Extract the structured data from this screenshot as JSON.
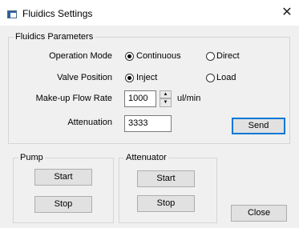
{
  "window": {
    "title": "Fluidics Settings",
    "close_glyph": "✕"
  },
  "fluidics": {
    "group_label": "Fluidics Parameters",
    "operation_mode": {
      "label": "Operation Mode",
      "options": [
        {
          "label": "Continuous",
          "selected": true
        },
        {
          "label": "Direct",
          "selected": false
        }
      ]
    },
    "valve_position": {
      "label": "Valve Position",
      "options": [
        {
          "label": "Inject",
          "selected": true
        },
        {
          "label": "Load",
          "selected": false
        }
      ]
    },
    "makeup_flow_rate": {
      "label": "Make-up Flow Rate",
      "value": "1000",
      "unit": "ul/min"
    },
    "attenuation": {
      "label": "Attenuation",
      "value": "3333"
    },
    "send_label": "Send"
  },
  "pump": {
    "group_label": "Pump",
    "start_label": "Start",
    "stop_label": "Stop"
  },
  "attenuator": {
    "group_label": "Attenuator",
    "start_label": "Start",
    "stop_label": "Stop"
  },
  "close_label": "Close",
  "icons": {
    "app": "window-app-icon",
    "close": "close-icon",
    "spin_up": "chevron-up-icon",
    "spin_down": "chevron-down-icon"
  }
}
